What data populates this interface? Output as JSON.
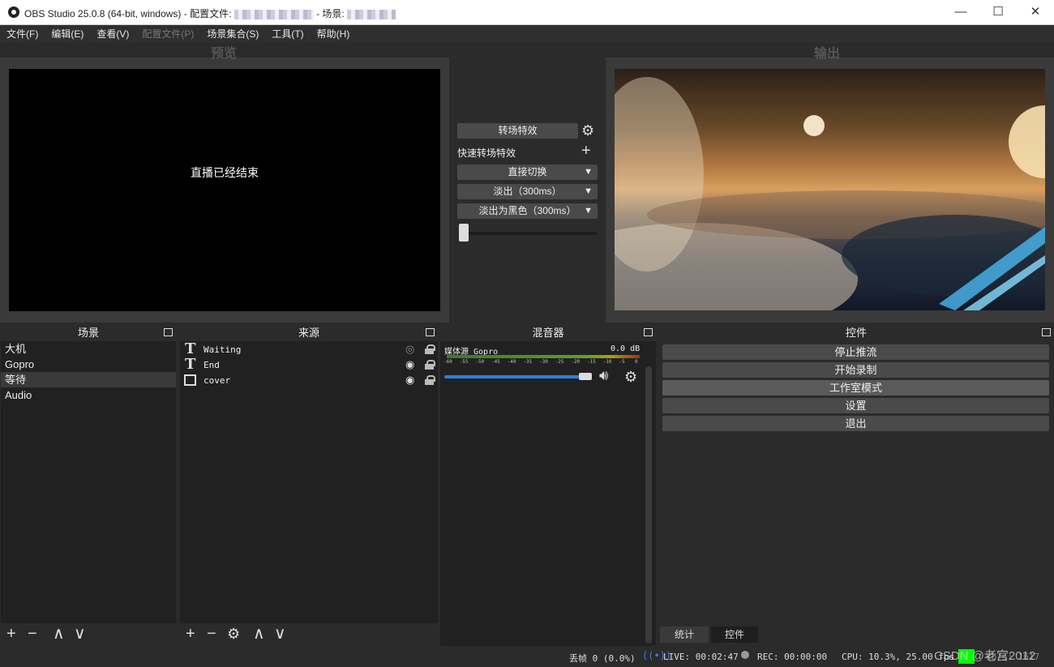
{
  "window": {
    "title_prefix": "OBS Studio 25.0.8 (64-bit, windows) - 配置文件: ",
    "title_mid": " - 场景: ",
    "minimize": "—",
    "maximize": "☐",
    "close": "✕"
  },
  "menu": [
    "文件(F)",
    "编辑(E)",
    "查看(V)",
    "配置文件(P)",
    "场景集合(S)",
    "工具(T)",
    "帮助(H)"
  ],
  "preview": {
    "label": "预览",
    "message": "直播已经结束"
  },
  "output": {
    "label": "输出"
  },
  "transitions": {
    "transition_button": "转场特效",
    "quick_label": "快速转场特效",
    "quick_add": "+",
    "combos": [
      "直接切换",
      "淡出（300ms）",
      "淡出为黑色（300ms）"
    ]
  },
  "scenes": {
    "title": "场景",
    "items": [
      "大机",
      "Gopro",
      "等待",
      "Audio"
    ],
    "selected_index": 2
  },
  "sources": {
    "title": "来源",
    "items": [
      {
        "name": "Waiting",
        "icon": "text-icon",
        "visible": false
      },
      {
        "name": "End",
        "icon": "text-icon",
        "visible": true
      },
      {
        "name": "cover",
        "icon": "image-icon",
        "visible": true
      }
    ]
  },
  "mixer": {
    "title": "混音器",
    "channel_name": "媒体源 Gopro",
    "level": "0.0 dB",
    "scale": [
      "-60",
      "-55",
      "-50",
      "-45",
      "-40",
      "-35",
      "-30",
      "-25",
      "-20",
      "-15",
      "-10",
      "-5",
      "0"
    ],
    "volume_fraction": 0.98
  },
  "controls": {
    "title": "控件",
    "buttons": [
      "停止推流",
      "开始录制",
      "工作室模式",
      "设置",
      "退出"
    ],
    "tabs": [
      "统计",
      "控件"
    ],
    "active_tab": 1
  },
  "toolbar": {
    "add": "+",
    "remove": "−",
    "up": "∧",
    "down": "∨",
    "gear": "⚙"
  },
  "status": {
    "dropped": "丢帧 0 (0.0%)",
    "live": "LIVE: 00:02:47",
    "rec": "REC: 00:00:00",
    "cpu": "CPU: 10.3%, 25.00 fps",
    "kbps": "kb/s: 1617",
    "watermark": "CSDN @老宫2012",
    "connection_color": "#00ff00"
  },
  "colors": {
    "accent": "#2a82da",
    "panel": "#212121",
    "background": "#2b2b2b"
  }
}
